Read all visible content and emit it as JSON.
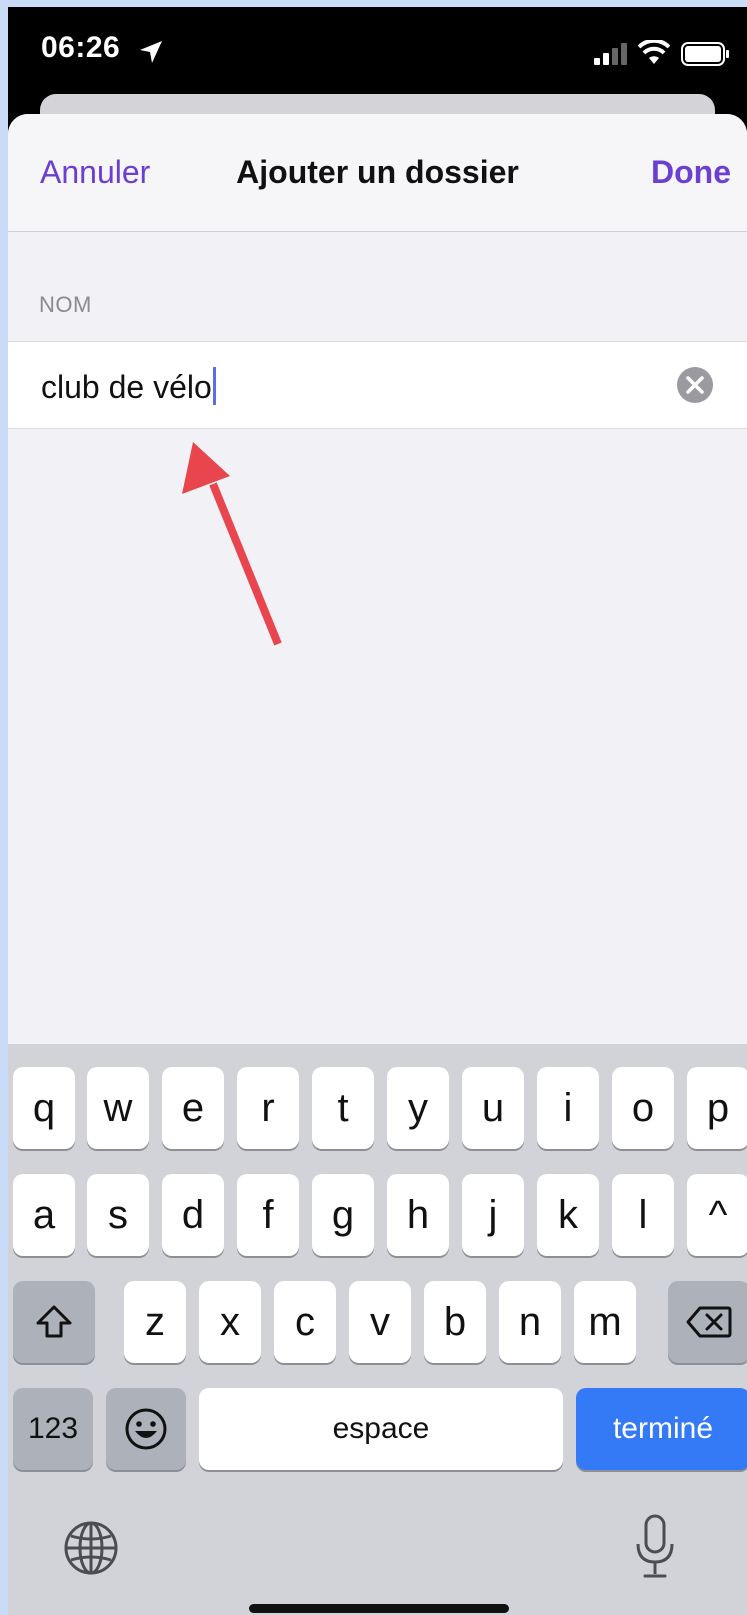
{
  "status_bar": {
    "time": "06:26"
  },
  "nav": {
    "cancel": "Annuler",
    "title": "Ajouter un dossier",
    "done": "Done"
  },
  "form": {
    "section_label": "NOM",
    "name_value": "club de vélo"
  },
  "keyboard": {
    "row1": [
      "q",
      "w",
      "e",
      "r",
      "t",
      "y",
      "u",
      "i",
      "o",
      "p"
    ],
    "row2": [
      "a",
      "s",
      "d",
      "f",
      "g",
      "h",
      "j",
      "k",
      "l",
      "^"
    ],
    "row3": [
      "z",
      "x",
      "c",
      "v",
      "b",
      "n",
      "m"
    ],
    "numbers": "123",
    "space": "espace",
    "return": "terminé"
  },
  "colors": {
    "accent": "#6a3fd2",
    "return_key": "#3479f6",
    "annotation_arrow": "#e8454e"
  }
}
